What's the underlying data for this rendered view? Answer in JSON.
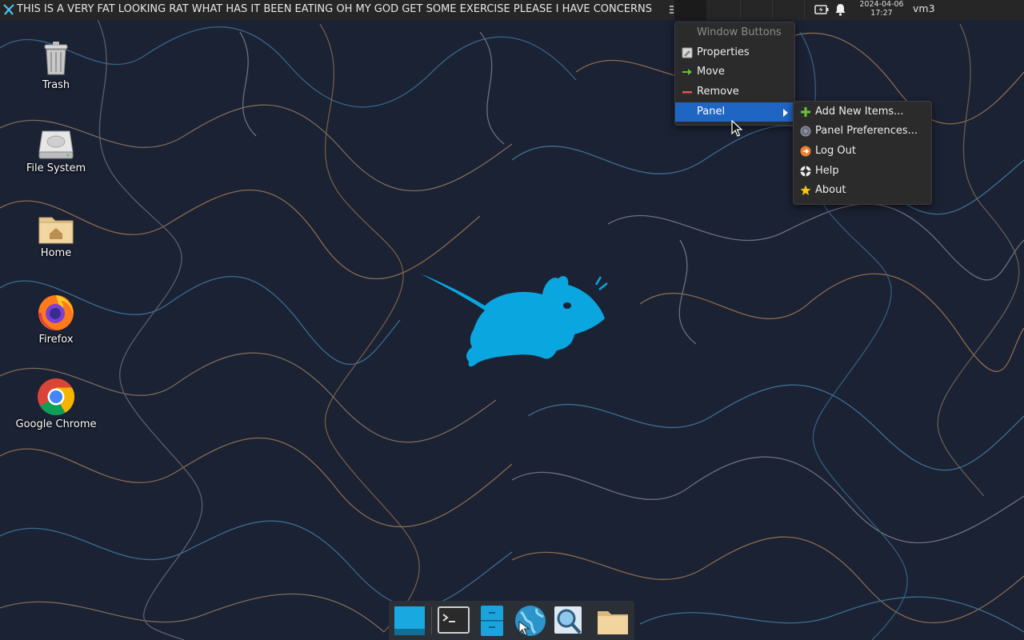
{
  "top_panel": {
    "window_title": "THIS IS A VERY FAT LOOKING RAT WHAT HAS IT BEEN EATING OH MY GOD GET SOME EXERCISE PLEASE I HAVE CONCERNS",
    "clock": {
      "date": "2024-04-06",
      "time": "17:27"
    },
    "hostname": "vm3",
    "tray_icons": [
      "battery-icon",
      "bell-icon"
    ]
  },
  "desktop": {
    "icons": [
      {
        "label": "Trash",
        "icon": "trash-icon"
      },
      {
        "label": "File System",
        "icon": "drive-icon"
      },
      {
        "label": "Home",
        "icon": "home-folder-icon"
      },
      {
        "label": "Firefox",
        "icon": "firefox-icon"
      },
      {
        "label": "Google Chrome",
        "icon": "chrome-icon"
      }
    ]
  },
  "context_menu": {
    "title": "Window Buttons",
    "items": [
      {
        "label": "Properties",
        "icon": "properties-icon"
      },
      {
        "label": "Move",
        "icon": "move-arrow-icon"
      },
      {
        "label": "Remove",
        "icon": "remove-icon"
      },
      {
        "label": "Panel",
        "icon": "",
        "selected": true,
        "has_submenu": true
      }
    ]
  },
  "submenu": {
    "items": [
      {
        "label": "Add New Items...",
        "icon": "add-icon"
      },
      {
        "label": "Panel Preferences...",
        "icon": "preferences-icon"
      },
      {
        "label": "Log Out",
        "icon": "logout-icon"
      },
      {
        "label": "Help",
        "icon": "help-icon"
      },
      {
        "label": "About",
        "icon": "about-star-icon"
      }
    ]
  },
  "dock": {
    "items": [
      "show-desktop-icon",
      "terminal-icon",
      "file-manager-icon",
      "web-browser-icon",
      "app-finder-icon",
      "folder-icon"
    ]
  },
  "colors": {
    "panel_bg": "#262626",
    "menu_bg": "#2b2b2b",
    "menu_selected": "#1e65c4",
    "wallpaper_bg": "#1a2233",
    "mascot": "#0aa6e0"
  }
}
